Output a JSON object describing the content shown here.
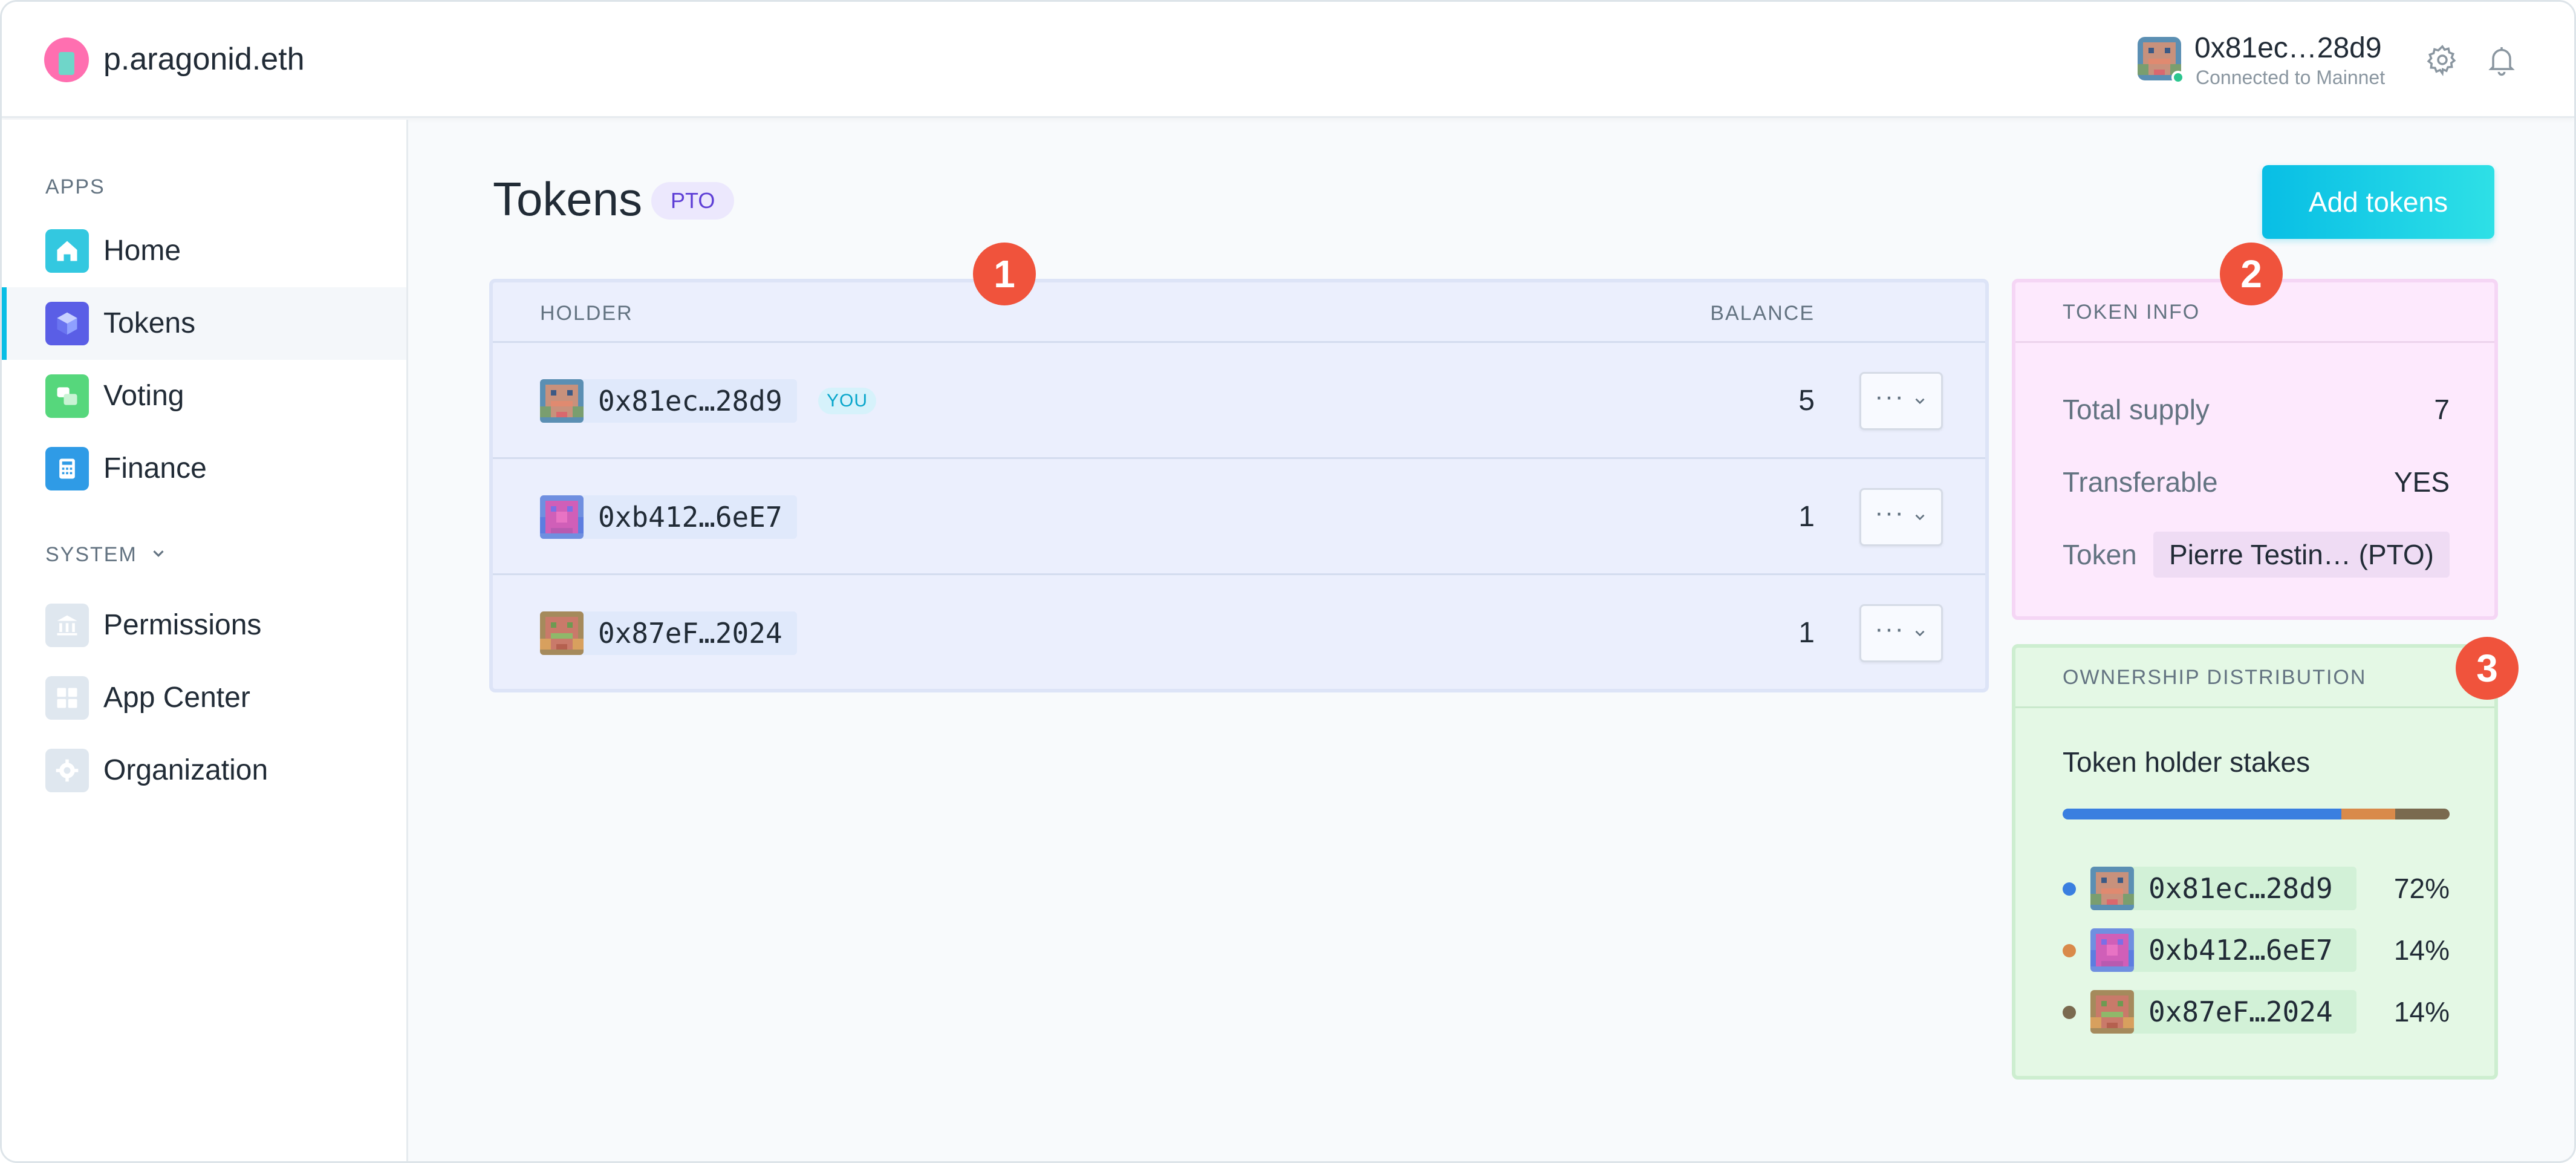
{
  "header": {
    "org_name": "p.aragonid.eth",
    "account_address": "0x81ec…28d9",
    "account_status": "Connected to Mainnet",
    "icons": [
      "gear-icon",
      "bell-icon"
    ]
  },
  "sidebar": {
    "apps_heading": "APPS",
    "system_heading": "SYSTEM",
    "apps": [
      {
        "label": "Home",
        "icon": "home-icon"
      },
      {
        "label": "Tokens",
        "icon": "tokens-icon"
      },
      {
        "label": "Voting",
        "icon": "voting-icon"
      },
      {
        "label": "Finance",
        "icon": "finance-icon"
      }
    ],
    "system": [
      {
        "label": "Permissions",
        "icon": "permissions-icon"
      },
      {
        "label": "App Center",
        "icon": "app-center-icon"
      },
      {
        "label": "Organization",
        "icon": "organization-icon"
      }
    ],
    "active_item": "Tokens",
    "accent_color": "#08bee5"
  },
  "main": {
    "title": "Tokens",
    "symbol_badge": "PTO",
    "add_button": "Add tokens"
  },
  "holders_table": {
    "columns": [
      "HOLDER",
      "BALANCE"
    ],
    "rows": [
      {
        "address": "0x81ec…28d9",
        "you_badge": "YOU",
        "balance": "5"
      },
      {
        "address": "0xb412…6eE7",
        "balance": "1"
      },
      {
        "address": "0x87eF…2024",
        "balance": "1"
      }
    ]
  },
  "token_info": {
    "heading": "TOKEN INFO",
    "total_supply_label": "Total supply",
    "total_supply": "7",
    "transferable_label": "Transferable",
    "transferable": "YES",
    "token_label": "Token",
    "token_value": "Pierre Testin… (PTO)"
  },
  "ownership": {
    "heading": "OWNERSHIP DISTRIBUTION",
    "subtitle": "Token holder stakes",
    "stakes": [
      {
        "address": "0x81ec…28d9",
        "percent": "72%",
        "share": 0.72,
        "color": "#3a7fe0"
      },
      {
        "address": "0xb412…6eE7",
        "percent": "14%",
        "share": 0.14,
        "color": "#d98a4a"
      },
      {
        "address": "0x87eF…2024",
        "percent": "14%",
        "share": 0.14,
        "color": "#7a6a4f"
      }
    ]
  },
  "markers": [
    "1",
    "2",
    "3"
  ],
  "colors": {
    "marker": "#f0533c",
    "holders_bg": "#ebeffd",
    "info_bg": "#fde9fd",
    "ownership_bg": "#e4f8e5"
  }
}
